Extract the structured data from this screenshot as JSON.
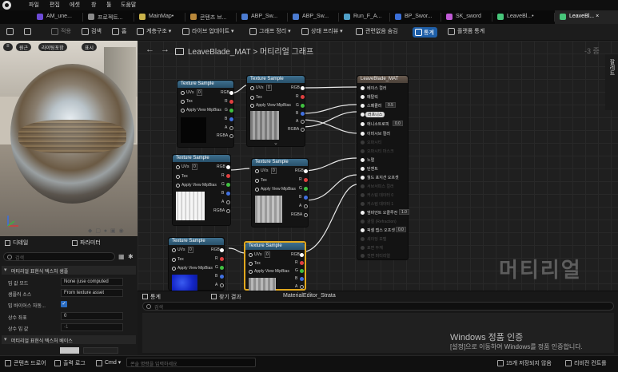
{
  "menu": [
    "파일",
    "편집",
    "에셋",
    "창",
    "툴",
    "도움말"
  ],
  "tabs": [
    {
      "label": "AM_une...",
      "color": "#6c4ad6"
    },
    {
      "label": "프로젝트...",
      "color": "#8a8a8a"
    },
    {
      "label": "MainMap•",
      "color": "#c9b24a"
    },
    {
      "label": "콘텐츠 브...",
      "color": "#b8873a"
    },
    {
      "label": "ABP_Sw...",
      "color": "#4b7bd0"
    },
    {
      "label": "ABP_Sw...",
      "color": "#4b7bd0"
    },
    {
      "label": "Run_F_A...",
      "color": "#4fa0c8"
    },
    {
      "label": "BP_Swor...",
      "color": "#3a6fd8"
    },
    {
      "label": "SK_sword",
      "color": "#c05ad6"
    },
    {
      "label": "LeaveBl...•",
      "color": "#47c67a"
    },
    {
      "label": "LeaveBl... ×",
      "color": "#47c67a"
    }
  ],
  "toolbar": {
    "apply": "적용",
    "search": "검색",
    "home": "홈",
    "hierarchy": "계층구조",
    "live_update": "라이브 업데이트",
    "graph_cleanup": "그래프 정리",
    "preview_state": "상태 프리뷰",
    "hide_unrelated": "관련없음 숨김",
    "stats": "통계",
    "platform_stats": "플랫폼 통계"
  },
  "viewport": {
    "perspective": "원근",
    "lit": "라이팅포함",
    "show": "표시"
  },
  "details": {
    "tab_details": "디테일",
    "tab_params": "파라미터",
    "search_placeholder": "검색",
    "section1": "머티리얼 표현식 텍스처 샘플",
    "rows": [
      {
        "label": "밉 값 모드",
        "value": "None (use computed"
      },
      {
        "label": "샘플러 소스",
        "value": "From texture asset"
      },
      {
        "label": "밉 바이어스 자동...",
        "value": "✓"
      },
      {
        "label": "상수 좌표",
        "value": "0"
      },
      {
        "label": "상수 밉 값",
        "value": "-1"
      }
    ],
    "section2": "머티리얼 표현식 텍스처 베이스"
  },
  "graph": {
    "breadcrumb_asset": "LeaveBlade_MAT",
    "breadcrumb_sep": ">",
    "breadcrumb_view": "머티리얼 그래프",
    "zoom": "-3 줌",
    "watermark": "머티리얼",
    "palette_label": "팔레트",
    "texture_node_title": "Texture Sample",
    "uv_label": "UVs",
    "uv_value": "0",
    "tex_label": "Tex",
    "apply_mip": "Apply View MipBias",
    "out_rgb": "RGB",
    "out_r": "R",
    "out_g": "G",
    "out_b": "B",
    "out_a": "A",
    "out_rgba": "RGBA",
    "material_node": {
      "title": "LeaveBlade_MAT",
      "pins": [
        {
          "label": "베이스 컬러",
          "active": true
        },
        {
          "label": "메탈릭",
          "active": true
        },
        {
          "label": "스페큘러",
          "active": true,
          "value": "0.5"
        },
        {
          "label": "러프니스",
          "active": true,
          "chip": true
        },
        {
          "label": "애니소트로피",
          "active": true,
          "value": "0.0"
        },
        {
          "label": "이미시브 컬러",
          "active": true
        },
        {
          "label": "오파시티",
          "active": false
        },
        {
          "label": "오파시티 마스크",
          "active": false
        },
        {
          "label": "노멀",
          "active": true
        },
        {
          "label": "탄젠트",
          "active": true
        },
        {
          "label": "월드 포지션 오프셋",
          "active": true
        },
        {
          "label": "서브서피스 컬러",
          "active": false
        },
        {
          "label": "커스텀 데이터 0",
          "active": false
        },
        {
          "label": "커스텀 데이터 1",
          "active": false
        },
        {
          "label": "앰비언트 오클루전",
          "active": true,
          "value": "1.0"
        },
        {
          "label": "굴절 (Refraction)",
          "active": false
        },
        {
          "label": "픽셀 뎁스 오프셋",
          "active": true,
          "value": "0.0"
        },
        {
          "label": "셰이딩 모델",
          "active": false
        },
        {
          "label": "표면 두께",
          "active": false
        },
        {
          "label": "전면 머티리얼",
          "active": false
        }
      ]
    }
  },
  "bottom": {
    "tab_stats": "통계",
    "tab_find": "찾기 결과",
    "tab_strata": "MaterialEditor_Strata",
    "search_placeholder": "검색",
    "windows_title": "Windows 정품 인증",
    "windows_sub": "[설정]으로 이동하여 Windows를 정품 인증합니다."
  },
  "status": {
    "content_drawer": "콘텐츠 드로어",
    "output_log": "출력 로그",
    "cmd": "Cmd",
    "cmd_placeholder": "콘솔 명령을 입력하세요",
    "unsaved": "15개 저장되지 않음",
    "revision": "리비전 컨트롤"
  }
}
